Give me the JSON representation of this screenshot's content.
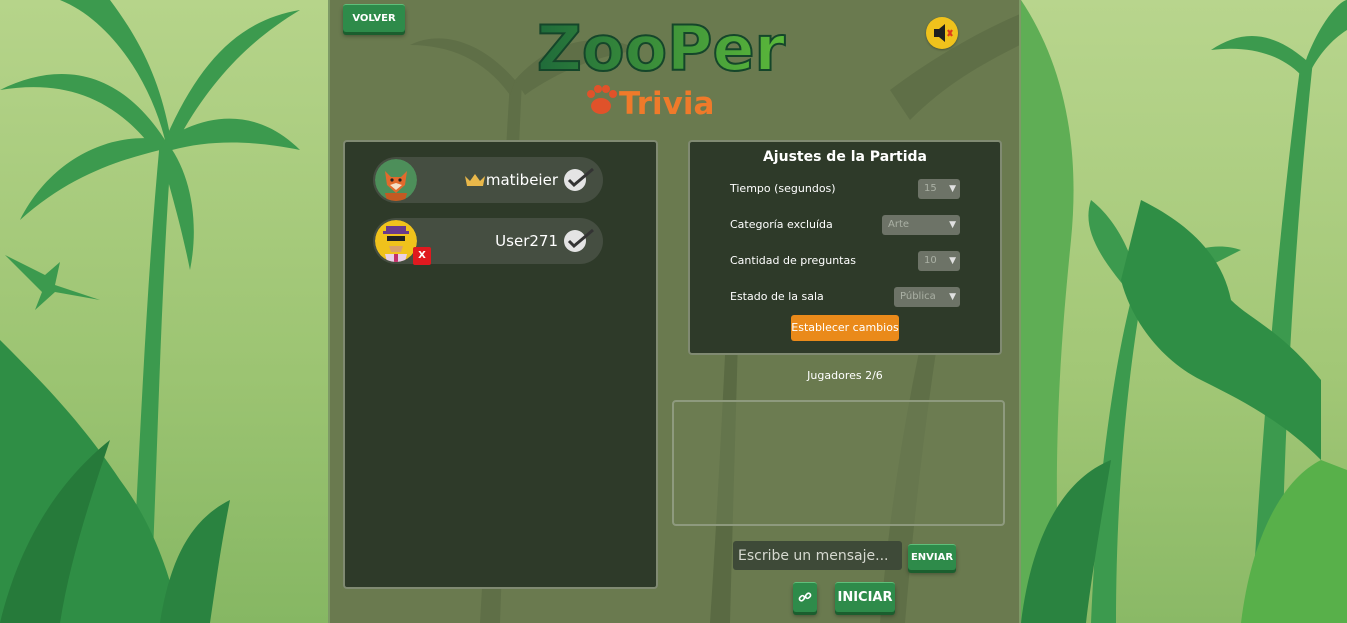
{
  "header": {
    "back_label": "VOLVER",
    "logo_main": "ZooPer",
    "logo_sub": "Trivia",
    "sound_icon": "speaker-muted-icon"
  },
  "players": [
    {
      "name": "matibeier",
      "is_host": true,
      "ready": true,
      "avatar": "fox-avatar"
    },
    {
      "name": "User271",
      "is_host": false,
      "ready": true,
      "avatar": "lion-avatar",
      "kick_label": "X"
    }
  ],
  "settings": {
    "title": "Ajustes de la Partida",
    "rows": [
      {
        "label": "Tiempo (segundos)",
        "value": "15"
      },
      {
        "label": "Categoría excluída",
        "value": "Arte"
      },
      {
        "label": "Cantidad de preguntas",
        "value": "10"
      },
      {
        "label": "Estado de la sala",
        "value": "Pública"
      }
    ],
    "apply_label": "Establecer cambios"
  },
  "players_count": "Jugadores 2/6",
  "chat": {
    "placeholder": "Escribe un mensaje...",
    "send_label": "ENVIAR"
  },
  "actions": {
    "start_label": "INICIAR",
    "link_icon": "link-icon"
  },
  "colors": {
    "accent_green": "#2e8b4a",
    "accent_orange": "#ea8a1a",
    "panel_bg": "#2e3a29"
  }
}
